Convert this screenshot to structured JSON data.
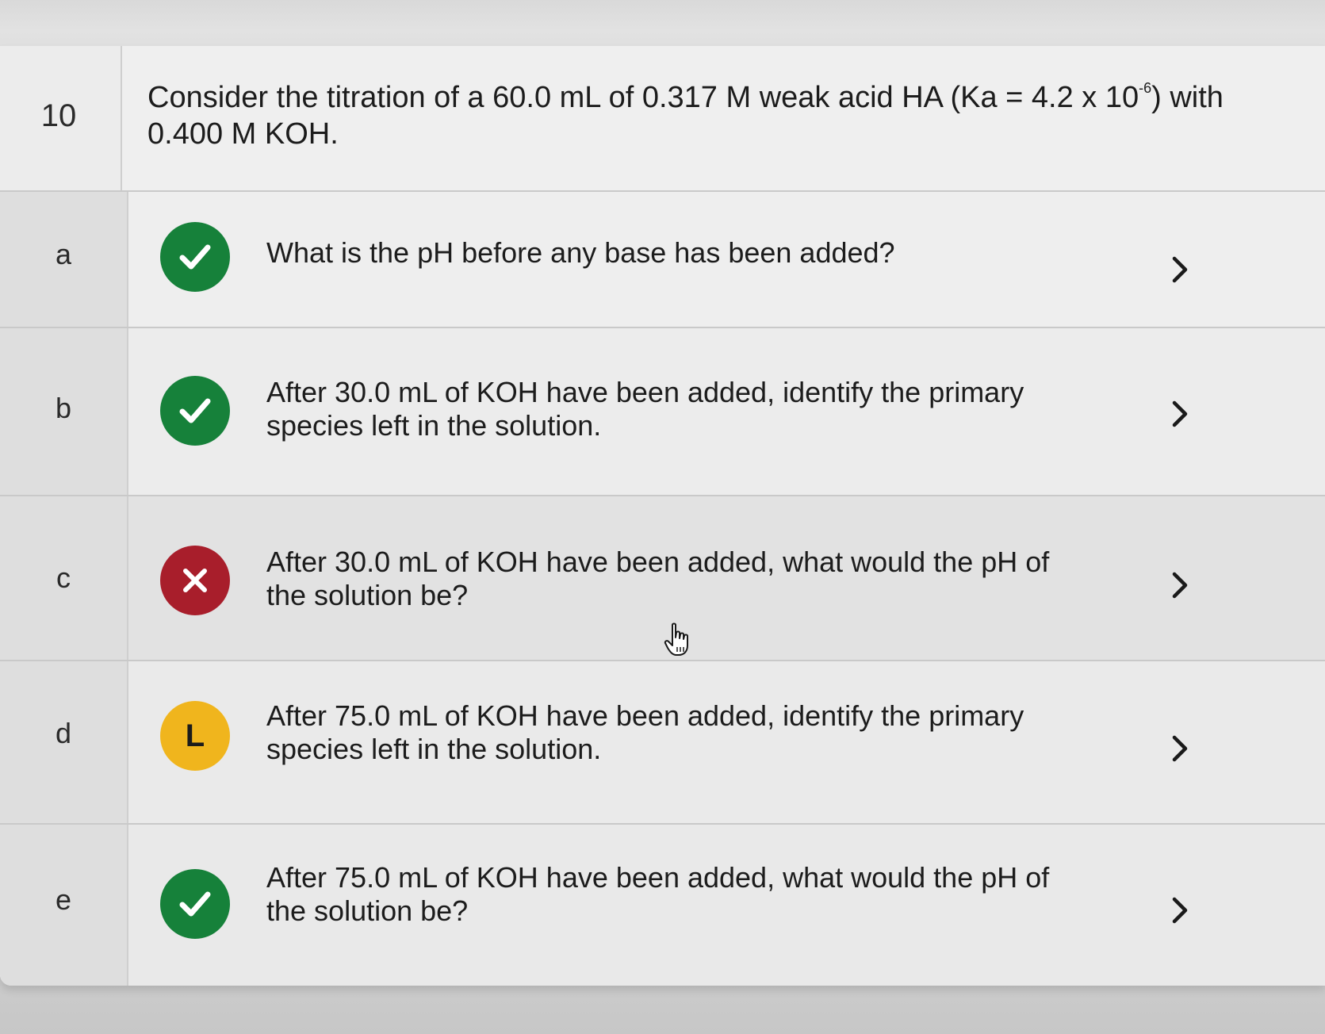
{
  "question": {
    "number": "10",
    "text_part1": "Consider the titration of a 60.0 mL of 0.317 M weak acid HA (Ka = 4.2 x 10",
    "exponent": "-6",
    "text_part2": ") with 0.400 M KOH."
  },
  "parts": [
    {
      "label": "a",
      "status": "correct",
      "status_icon": "checkmark-icon",
      "text": "What is the pH before any base has been added?",
      "chevron_icon": "chevron-right-icon"
    },
    {
      "label": "b",
      "status": "correct",
      "status_icon": "checkmark-icon",
      "text": "After 30.0 mL of KOH have been added, identify the primary species left in the solution.",
      "chevron_icon": "chevron-right-icon"
    },
    {
      "label": "c",
      "status": "incorrect",
      "status_icon": "x-icon",
      "text": "After 30.0 mL of KOH have been added, what would the pH of the solution be?",
      "chevron_icon": "chevron-right-icon"
    },
    {
      "label": "d",
      "status": "partial",
      "status_icon": "l-icon",
      "status_glyph": "L",
      "text": "After 75.0 mL of KOH have been added, identify the primary species left in the solution.",
      "chevron_icon": "chevron-right-icon"
    },
    {
      "label": "e",
      "status": "correct",
      "status_icon": "checkmark-icon",
      "text": "After 75.0 mL of KOH have been added, what would the pH of the solution be?",
      "chevron_icon": "chevron-right-icon"
    }
  ],
  "colors": {
    "correct": "#16813a",
    "incorrect": "#a81e2b",
    "partial": "#f0b51d"
  },
  "cursor_icon": "hand-pointer-icon"
}
